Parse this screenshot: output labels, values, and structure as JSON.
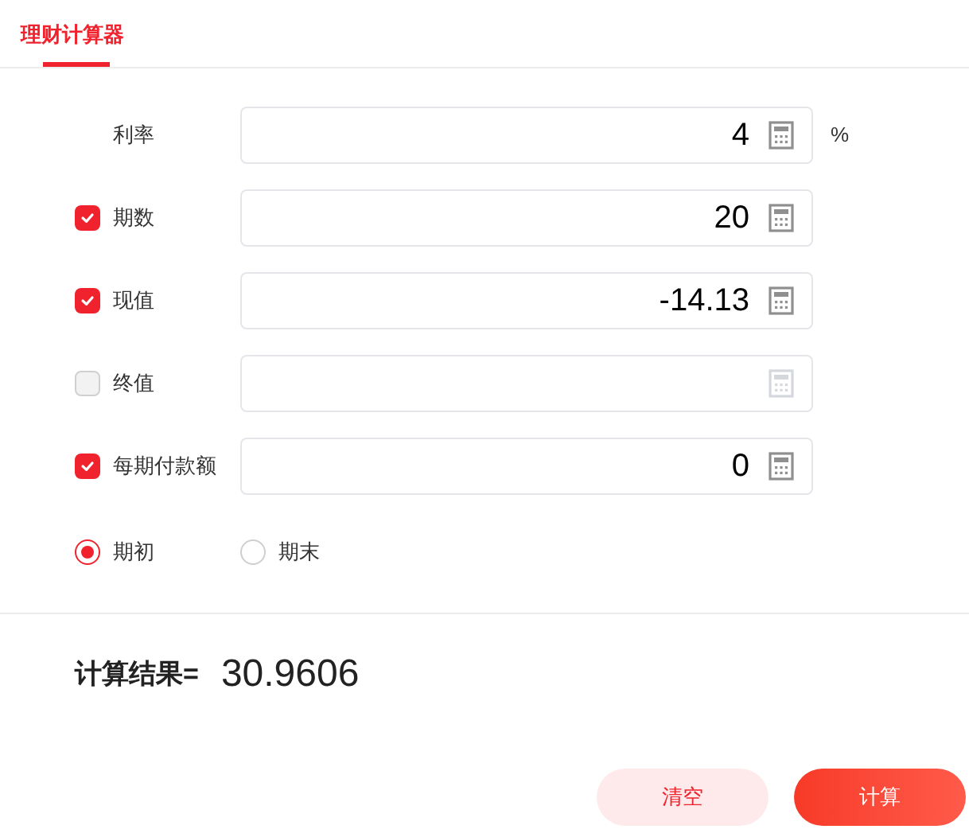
{
  "tabs": [
    {
      "label": "理财计算器",
      "selected": true
    }
  ],
  "rows": [
    {
      "kind": "plain",
      "label": "利率",
      "value": "4",
      "suffix": "%"
    },
    {
      "kind": "checkbox",
      "label": "期数",
      "checked": true,
      "value": "20"
    },
    {
      "kind": "checkbox",
      "label": "现值",
      "checked": true,
      "value": "-14.13"
    },
    {
      "kind": "checkbox",
      "label": "终值",
      "checked": false
    },
    {
      "kind": "checkbox",
      "label": "每期付款额",
      "checked": true,
      "value": "0"
    }
  ],
  "timing": [
    {
      "label": "期初",
      "selected": true
    },
    {
      "label": "期末",
      "selected": false
    }
  ],
  "result": {
    "label": "计算结果=",
    "value": "30.9606"
  },
  "buttons": [
    {
      "kind": "secondary",
      "label": "清空"
    },
    {
      "kind": "primary",
      "label": "计算"
    }
  ]
}
